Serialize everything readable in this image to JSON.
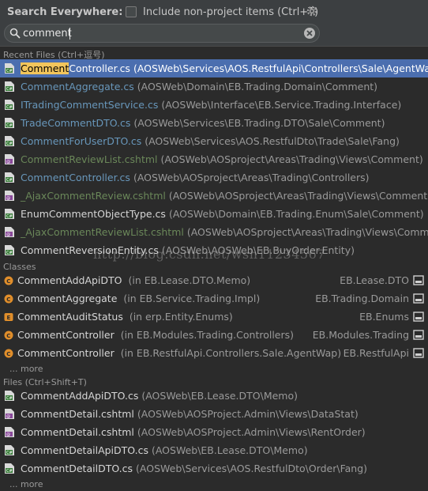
{
  "header": {
    "title": "Search Everywhere:",
    "include_label": "Include non-project items (Ctrl+T)",
    "include_checked": false
  },
  "search": {
    "value": "comment"
  },
  "recent_files": {
    "label": "Recent Files (Ctrl+逗号)",
    "items": [
      {
        "match": "Comment",
        "rest": "Controller.cs",
        "loc": "(AOSWeb\\Services\\AOS.RestfulApi\\Controllers\\Sale\\AgentWap)",
        "icon": "cs-file-icon"
      },
      {
        "match": "",
        "rest": "CommentAggregate.cs",
        "loc": "(AOSWeb\\Domain\\EB.Trading.Domain\\Comment)",
        "icon": "cs-file-icon"
      },
      {
        "match": "",
        "rest": "ITradingCommentService.cs",
        "loc": "(AOSWeb\\Interface\\EB.Service.Trading.Interface)",
        "icon": "cs-file-icon"
      },
      {
        "match": "",
        "rest": "TradeCommentDTO.cs",
        "loc": "(AOSWeb\\Services\\EB.Trading.DTO\\Sale\\Comment)",
        "icon": "cs-file-icon"
      },
      {
        "match": "",
        "rest": "CommentForUserDTO.cs",
        "loc": "(AOSWeb\\Services\\AOS.RestfulDto\\Trade\\Sale\\Fang)",
        "icon": "cs-file-icon"
      },
      {
        "match": "",
        "rest": "CommentReviewList.cshtml",
        "loc": "(AOSWeb\\AOSproject\\Areas\\Trading\\Views\\Comment)",
        "icon": "cshtml-file-icon"
      },
      {
        "match": "",
        "rest": "CommentController.cs",
        "loc": "(AOSWeb\\AOSproject\\Areas\\Trading\\Controllers)",
        "icon": "cs-file-icon"
      },
      {
        "match": "",
        "rest": "_AjaxCommentReview.cshtml",
        "loc": "(AOSWeb\\AOSproject\\Areas\\Trading\\Views\\Comment)",
        "icon": "cshtml-file-icon"
      },
      {
        "match": "",
        "rest": "EnumCommentObjectType.cs",
        "loc": "(AOSWeb\\Domain\\EB.Trading.Enum\\Sale\\Comment)",
        "icon": "cs-file-icon"
      },
      {
        "match": "",
        "rest": "_AjaxCommentReviewList.cshtml",
        "loc": "(AOSWeb\\AOSproject\\Areas\\Trading\\Views\\Comment)",
        "icon": "cshtml-file-icon"
      },
      {
        "match": "",
        "rest": "CommentReversionEntity.cs",
        "loc": "(AOSWeb\\AOSWeb\\EB.BuyOrder.Entity)",
        "icon": "cs-file-icon"
      }
    ]
  },
  "classes": {
    "label": "Classes",
    "items": [
      {
        "name": "CommentAddApiDTO",
        "pkg": "(in EB.Lease.DTO.Memo)",
        "module": "EB.Lease.DTO"
      },
      {
        "name": "CommentAggregate",
        "pkg": "(in EB.Service.Trading.Impl)",
        "module": "EB.Trading.Domain"
      },
      {
        "name": "CommentAuditStatus",
        "pkg": "(in erp.Entity.Enums)",
        "module": "EB.Enums"
      },
      {
        "name": "CommentController",
        "pkg": "(in EB.Modules.Trading.Controllers)",
        "module": "EB.Modules.Trading"
      },
      {
        "name": "CommentController",
        "pkg": "(in EB.RestfulApi.Controllers.Sale.AgentWap)",
        "module": "EB.RestfulApi"
      }
    ],
    "more": "... more"
  },
  "files": {
    "label": "Files (Ctrl+Shift+T)",
    "items": [
      {
        "name": "CommentAddApiDTO.cs",
        "loc": "(AOSWeb\\EB.Lease.DTO\\Memo)"
      },
      {
        "name": "CommentDetail.cshtml",
        "loc": "(AOSWeb\\AOSProject.Admin\\Views\\DataStat)"
      },
      {
        "name": "CommentDetail.cshtml",
        "loc": "(AOSWeb\\AOSProject.Admin\\Views\\RentOrder)"
      },
      {
        "name": "CommentDetailApiDTO.cs",
        "loc": "(AOSWeb\\EB.Lease.DTO\\Memo)"
      },
      {
        "name": "CommentDetailDTO.cs",
        "loc": "(AOSWeb\\Services\\AOS.RestfulDto\\Order\\Fang)"
      }
    ],
    "more": "... more"
  },
  "watermark": "http://blog.csdn.net/wsh11234567",
  "colors": {
    "background": "#2b2b2b",
    "header": "#3c3f41",
    "selection": "#4b6eaf",
    "highlight": "#f2c55c",
    "blue_file": "#6897bb",
    "green_file": "#6a8759"
  }
}
